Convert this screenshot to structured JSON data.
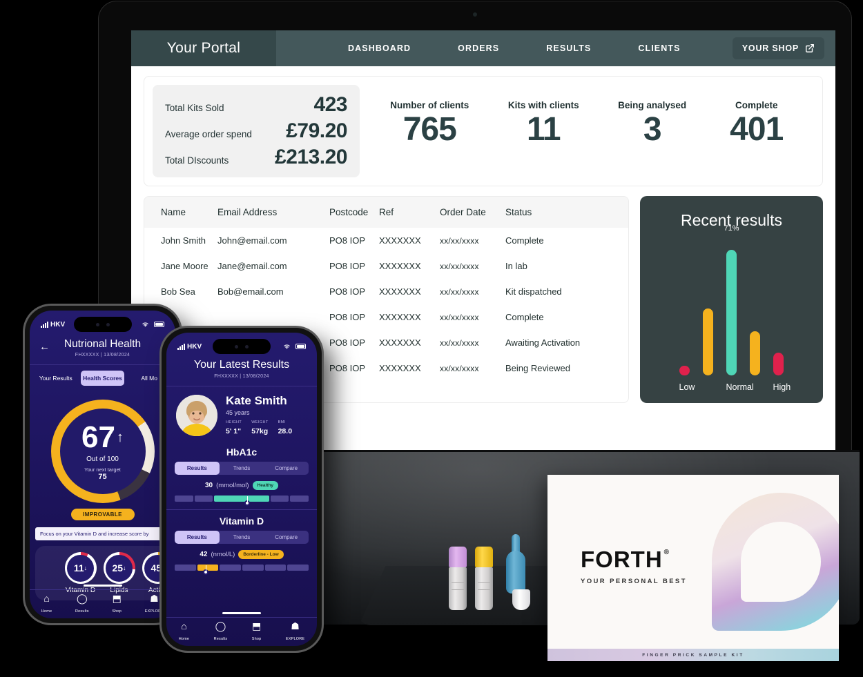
{
  "portal": {
    "brand": "Your Portal",
    "nav": [
      "DASHBOARD",
      "ORDERS",
      "RESULTS",
      "CLIENTS"
    ],
    "shop_button": "YOUR SHOP",
    "shop_icon": "external-link-icon"
  },
  "stats": {
    "money": [
      {
        "label": "Total Kits Sold",
        "value": "423"
      },
      {
        "label": "Average order spend",
        "value": "£79.20"
      },
      {
        "label": "Total DIscounts",
        "value": "£213.20"
      }
    ],
    "kpis": [
      {
        "label": "Number of clients",
        "value": "765"
      },
      {
        "label": "Kits with clients",
        "value": "11"
      },
      {
        "label": "Being analysed",
        "value": "3"
      },
      {
        "label": "Complete",
        "value": "401"
      }
    ]
  },
  "table": {
    "columns": [
      "Name",
      "Email Address",
      "Postcode",
      "Ref",
      "Order Date",
      "Status"
    ],
    "rows": [
      [
        "John Smith",
        "John@email.com",
        "PO8 IOP",
        "XXXXXXX",
        "xx/xx/xxxx",
        "Complete"
      ],
      [
        "Jane Moore",
        "Jane@email.com",
        "PO8 IOP",
        "XXXXXXX",
        "xx/xx/xxxx",
        "In lab"
      ],
      [
        "Bob Sea",
        "Bob@email.com",
        "PO8 IOP",
        "XXXXXXX",
        "xx/xx/xxxx",
        "Kit dispatched"
      ],
      [
        "",
        "",
        "PO8 IOP",
        "XXXXXXX",
        "xx/xx/xxxx",
        "Complete"
      ],
      [
        "",
        "",
        "PO8 IOP",
        "XXXXXXX",
        "xx/xx/xxxx",
        "Awaiting Activation"
      ],
      [
        "",
        "",
        "PO8 IOP",
        "XXXXXXX",
        "xx/xx/xxxx",
        "Being Reviewed"
      ]
    ]
  },
  "chart_data": {
    "type": "bar",
    "title": "Recent results",
    "categories": [
      "Low",
      "",
      "Normal",
      "",
      "High"
    ],
    "tick_labels": [
      "Low",
      "Normal",
      "High"
    ],
    "values": [
      5,
      38,
      71,
      25,
      13
    ],
    "data_labels": [
      "",
      "",
      "71%",
      "",
      ""
    ],
    "colors": [
      "#e0214c",
      "#f5b21e",
      "#4fd6b6",
      "#f5b21e",
      "#e0214c"
    ],
    "ylabel": "",
    "xlabel": "",
    "ylim": [
      0,
      80
    ],
    "grid": false,
    "legend": "none",
    "panel_background": "#364243"
  },
  "phone_left": {
    "carrier": "HKV",
    "back_icon": "arrow-left-icon",
    "title": "Nutrional Health",
    "subtitle": "FHXXXXX   |   13/08/2024",
    "tabs": [
      "Your Results",
      "Health Scores",
      "All Mo"
    ],
    "active_tab": "Health Scores",
    "score": "67",
    "score_arrow": "↑",
    "out_of": "Out of 100",
    "next_target_label": "Your next target",
    "next_target": "75",
    "status_pill": "IMPROVABLE",
    "tip": "Focus on your Vitamin D and increase score by",
    "minis": [
      {
        "value": "11",
        "arrow": "↓",
        "label": "Vitamin D"
      },
      {
        "value": "25",
        "arrow": "↓",
        "label": "Lipids"
      },
      {
        "value": "45",
        "arrow": "↑",
        "label": "Active"
      }
    ],
    "nav": [
      {
        "icon": "home-icon",
        "glyph": "⌂",
        "label": "Home"
      },
      {
        "icon": "results-icon",
        "glyph": "◯",
        "label": "Results"
      },
      {
        "icon": "shop-cart-icon",
        "glyph": "⬒",
        "label": "Shop"
      },
      {
        "icon": "explore-icon",
        "glyph": "☗",
        "label": "EXPLORE"
      }
    ]
  },
  "phone_front": {
    "carrier": "HKV",
    "title": "Your Latest Results",
    "subtitle": "FHXXXXX   |   13/08/2024",
    "person": {
      "name": "Kate Smith",
      "age": "45 years",
      "metrics": [
        {
          "key": "HEIGHT",
          "value": "5' 1\""
        },
        {
          "key": "WEIGHT",
          "value": "57kg"
        },
        {
          "key": "BMI",
          "value": "28.0"
        }
      ]
    },
    "biomarkers": [
      {
        "name": "HbA1c",
        "segments": [
          "Results",
          "Trends",
          "Compare"
        ],
        "active": "Results",
        "value": "30",
        "unit": "(mmol/mol)",
        "tag": "Healthy",
        "tag_type": "ok"
      },
      {
        "name": "Vitamin D",
        "segments": [
          "Results",
          "Trends",
          "Compare"
        ],
        "active": "Results",
        "value": "42",
        "unit": "(nmol/L)",
        "tag": "Borderline - Low",
        "tag_type": "warn"
      }
    ],
    "nav": [
      {
        "icon": "home-icon",
        "glyph": "⌂",
        "label": "Home"
      },
      {
        "icon": "results-icon",
        "glyph": "◯",
        "label": "Results"
      },
      {
        "icon": "shop-cart-icon",
        "glyph": "⬒",
        "label": "Shop"
      },
      {
        "icon": "explore-icon",
        "glyph": "☗",
        "label": "EXPLORE"
      }
    ]
  },
  "kit_box": {
    "brand": "FORTH",
    "trademark": "®",
    "tagline": "YOUR PERSONAL BEST",
    "strip_text": "FINGER PRICK SAMPLE KIT"
  },
  "colors": {
    "header": "#44585b",
    "brand_block": "#35484a",
    "panel_dark": "#364243",
    "teal": "#4fd6b6",
    "yellow": "#f5b21e",
    "red": "#e0214c",
    "phone_purple": "#241b6e"
  }
}
